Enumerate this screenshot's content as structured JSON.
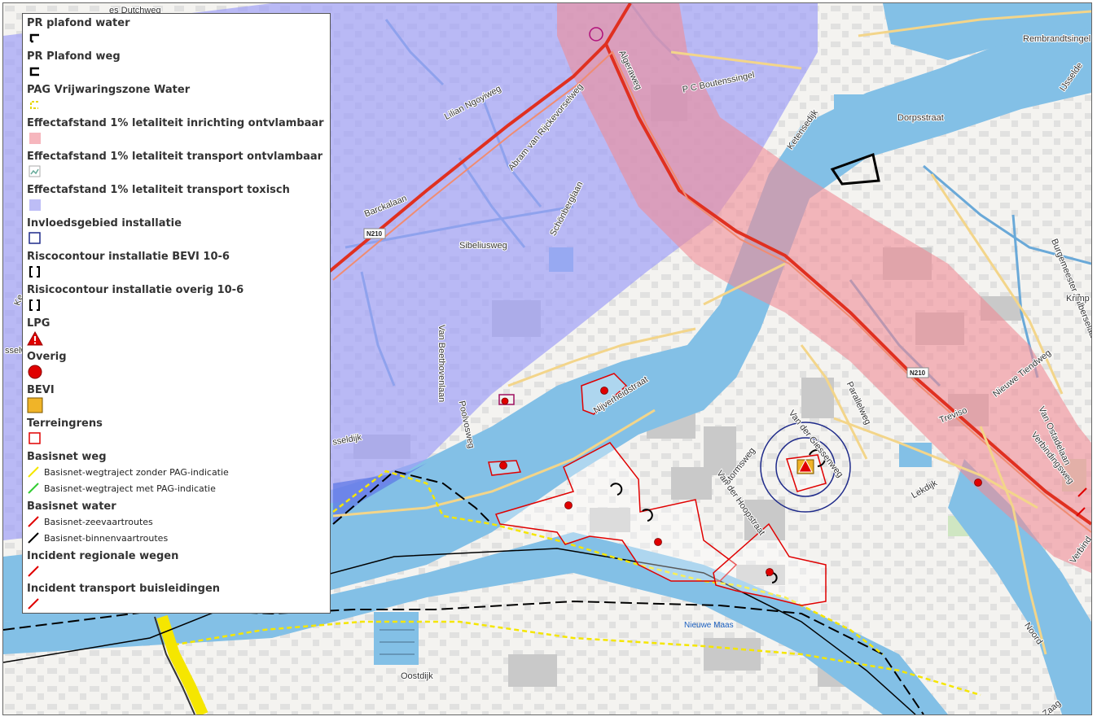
{
  "map": {
    "streets": [
      "Rembrandtsingel",
      "Dorpsstraat",
      "IJsselde",
      "Lilian Ngoyiweg",
      "Abram van Rijckevorselweg",
      "Algeraweg",
      "P C Boutenssingel",
      "Ketensedijk",
      "Barckalaan",
      "Schönberglaan",
      "Sibeliusweg",
      "Van Beethovenlaan",
      "Burgemeester Aalberselaan",
      "Krimp",
      "Nijverheidstraat",
      "Parallelweg",
      "Poolvosweg",
      "Nieuwe Tiendweg",
      "Van der Giessenweg",
      "Stormsweg",
      "Van der Hoopstraat",
      "Treviso",
      "Van Ostadelaan",
      "Verbindingsweg",
      "Lekdijk",
      "Noord",
      "Oostdijk",
      "Zaag",
      "Verbind",
      "Ke",
      "sselw",
      "sseldijk",
      "es Dutchweg"
    ],
    "roads": [
      "N210",
      "N210",
      "N210"
    ],
    "water": [
      "Nieuwe Maas"
    ]
  },
  "legend": {
    "items": [
      {
        "title": "PR plafond water",
        "symbol": "bracket-black-icon"
      },
      {
        "title": "PR Plafond weg",
        "symbol": "bracket-black-icon"
      },
      {
        "title": "PAG Vrijwaringszone Water",
        "symbol": "bracket-yellow-dashed-icon"
      },
      {
        "title": "Effectafstand 1% letaliteit inrichting ontvlambaar",
        "symbol": "pink-square-icon"
      },
      {
        "title": "Effectafstand 1% letaliteit transport ontvlambaar",
        "symbol": "broken-image-icon"
      },
      {
        "title": "Effectafstand 1% letaliteit transport toxisch",
        "symbol": "lavender-square-icon"
      },
      {
        "title": "Invloedsgebied installatie",
        "symbol": "blue-outline-square-icon"
      },
      {
        "title": "Riscocontour installatie BEVI 10-6",
        "symbol": "black-bracket-pair-icon"
      },
      {
        "title": "Risicocontour installatie overig 10-6",
        "symbol": "black-bracket-pair-icon"
      },
      {
        "title": "LPG",
        "symbol": "lpg-warning-icon"
      },
      {
        "title": "Overig",
        "symbol": "red-dot-icon"
      },
      {
        "title": "BEVI",
        "symbol": "orange-square-icon"
      },
      {
        "title": "Terreingrens",
        "symbol": "red-outline-square-icon"
      }
    ],
    "basisnet_weg": {
      "title": "Basisnet weg",
      "rows": [
        {
          "label": "Basisnet-wegtraject zonder PAG-indicatie",
          "color": "#f5e600"
        },
        {
          "label": "Basisnet-wegtraject met PAG-indicatie",
          "color": "#33cc33"
        }
      ]
    },
    "basisnet_water": {
      "title": "Basisnet water",
      "rows": [
        {
          "label": "Basisnet-zeevaartroutes",
          "color": "#e00000"
        },
        {
          "label": "Basisnet-binnenvaartroutes",
          "color": "#000000"
        }
      ]
    },
    "incident_wegen": {
      "title": "Incident regionale wegen",
      "color": "#e00000"
    },
    "incident_buis": {
      "title": "Incident transport buisleidingen",
      "color": "#e00000"
    }
  },
  "colors": {
    "water": "#83c0e6",
    "toxic": "#9f9ff6",
    "flammable": "#f08c96",
    "terrain": "#e00000",
    "bevi": "#f0b428",
    "road_main": "#e03020"
  }
}
